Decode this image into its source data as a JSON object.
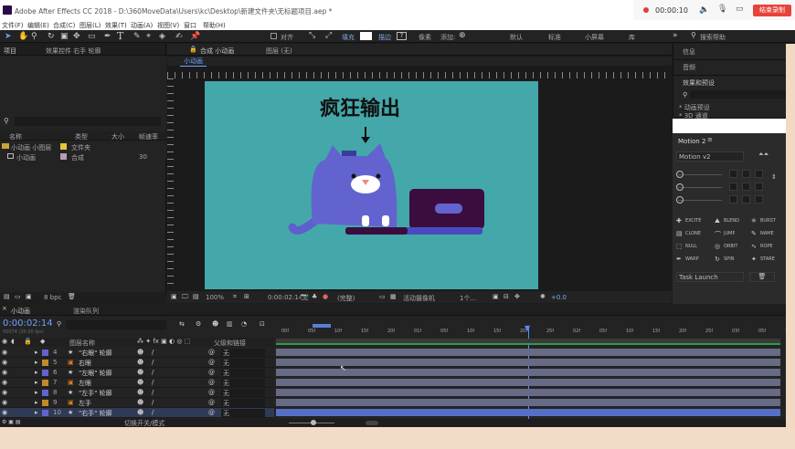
{
  "app_title": "Adobe After Effects CC 2018 - D:\\360MoveData\\Users\\kc\\Desktop\\新建文件夹\\无标题项目.aep *",
  "recording": {
    "timer": "00:00:10",
    "end_label": "结束录制"
  },
  "menu": [
    "文件(F)",
    "编辑(E)",
    "合成(C)",
    "图层(L)",
    "效果(T)",
    "动画(A)",
    "视图(V)",
    "窗口",
    "帮助(H)"
  ],
  "toolbar": {
    "snap_label": "对齐",
    "fill_label": "填充",
    "stroke_label": "描边",
    "px_label": "像素",
    "add_label": "添加:",
    "workspaces": [
      "默认",
      "标准",
      "小屏幕",
      "库"
    ],
    "search_placeholder": "搜索帮助"
  },
  "project": {
    "tab": "项目",
    "effect_tab": "效果控件 右手 轮廓",
    "columns": [
      "名称",
      "类型",
      "大小",
      "帧速率"
    ],
    "items": [
      {
        "name": "小动画 小图层",
        "type": "文件夹",
        "size": "",
        "rate": ""
      },
      {
        "name": "小动画",
        "type": "合成",
        "size": "",
        "rate": "30"
      }
    ],
    "bpc": "8 bpc"
  },
  "composition": {
    "tab": "合成 小动画",
    "layer_tab": "图层 (无)",
    "subtab": "小动画",
    "canvas_title": "疯狂输出",
    "bg_color": "#44a8aa",
    "zoom": "100%",
    "timecode": "0:00:02:14",
    "quality": "(完整)",
    "camera": "活动摄像机",
    "views": "1个...",
    "exposure": "+0.0"
  },
  "right_panels": {
    "info": "信息",
    "audio": "音频",
    "presets": "效果和预设",
    "preset_items": [
      "* 动画预设",
      "* 3D 通道"
    ]
  },
  "motion": {
    "title": "Motion 2",
    "version": "Motion v2",
    "buttons": [
      "EXCITE",
      "BLEND",
      "BURST",
      "CLONE",
      "JUMP",
      "NAME",
      "NULL",
      "ORBIT",
      "ROPE",
      "WARP",
      "SPIN",
      "STARE"
    ],
    "task": "Task Launch"
  },
  "timeline": {
    "tab": "小动画",
    "render_tab": "渲染队列",
    "timecode": "0:00:02:14",
    "frames": "00074 (30.00 fps)",
    "columns": [
      "图层名称",
      "父级和链接"
    ],
    "ruler": [
      "00f",
      "05f",
      "10f",
      "15f",
      "20f",
      "01f",
      "05f",
      "10f",
      "15f",
      "20f",
      "25f",
      "02f",
      "05f",
      "10f",
      "15f",
      "20f",
      "25f",
      "03f",
      "05f",
      "10f"
    ],
    "layers": [
      {
        "num": "4",
        "name": "\"右眼\" 轮廓",
        "parent": "无"
      },
      {
        "num": "5",
        "name": "右眼",
        "parent": "无"
      },
      {
        "num": "6",
        "name": "\"左眼\" 轮廓",
        "parent": "无"
      },
      {
        "num": "7",
        "name": "左眼",
        "parent": "无"
      },
      {
        "num": "8",
        "name": "\"左手\" 轮廓",
        "parent": "无"
      },
      {
        "num": "9",
        "name": "左手",
        "parent": "无"
      },
      {
        "num": "10",
        "name": "\"右手\" 轮廓",
        "parent": "无"
      }
    ],
    "footer": "切换开关/模式"
  }
}
